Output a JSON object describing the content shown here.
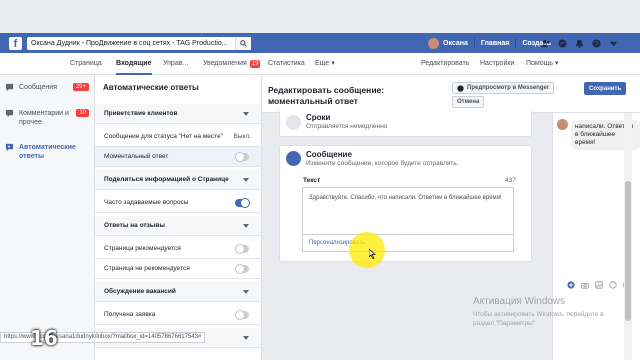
{
  "browser": {
    "tab_title": "Оксана Дудник - ПроДвижение в соц сетях - TAG Productio..."
  },
  "topbar": {
    "user_name": "Оксана",
    "home": "Главная",
    "create": "Создать"
  },
  "nav": {
    "page": "Страница",
    "inbox": "Входящие",
    "manage": "Управ...",
    "notifications": "Уведомления",
    "notifications_badge": "19",
    "stats": "Статистика",
    "more": "Еще ▾",
    "edit": "Редактировать",
    "settings": "Настройки",
    "help": "Помощь ▾"
  },
  "sidebar": {
    "items": [
      {
        "label": "Сообщения",
        "badge": "29+"
      },
      {
        "label": "Комментарии и прочее",
        "badge": "10"
      },
      {
        "label": "Автоматические ответы",
        "badge": ""
      }
    ]
  },
  "settings": {
    "title": "Автоматические ответы",
    "rows": {
      "r0": "Приветствие клиентов",
      "r1": "Сообщение для статуса \"Нет на месте\"",
      "r1_value": "Выкл.",
      "r2": "Моментальный ответ",
      "r3": "Поделиться информацией о Странице",
      "r4": "Часто задаваемые вопросы",
      "r5": "Ответы на отзывы",
      "r6": "Страница рекомендуется",
      "r7": "Страница не рекомендуется",
      "r8": "Обсуждение вакансий",
      "r9": "Получена заявка"
    }
  },
  "editor": {
    "title": "Редактировать сообщение: моментальный ответ",
    "preview_button": "Предпросмотр в Messenger",
    "save_button": "Сохранить",
    "cancel_button": "Отмена",
    "timing": {
      "title": "Сроки",
      "subtitle": "Отправляется немедленно"
    },
    "message": {
      "title": "Сообщение",
      "subtitle": "Измените сообщение, которое будете отправлять.",
      "text_label": "Текст",
      "char_count": "437",
      "text_value": "Здравствуйте. Спасибо, что написали. Ответим в ближайшее время!",
      "personalize": "Персонализировать"
    }
  },
  "preview": {
    "bubble_text": "написали. Ответим в ближайшее время!"
  },
  "watermark": {
    "line1": "Активация Windows",
    "line2": "Чтобы активировать Windows, перейдите в раздел \"Параметры\"."
  },
  "statusbar": {
    "url": "https://www...com/oksana1dudnyk/inbox/?mailbox_id=140578676617543#"
  },
  "overlay": {
    "number": "16"
  },
  "colors": {
    "facebook_blue": "#4267b2",
    "badge_red": "#fa3e3e",
    "highlight_yellow": "#ffeb00"
  }
}
